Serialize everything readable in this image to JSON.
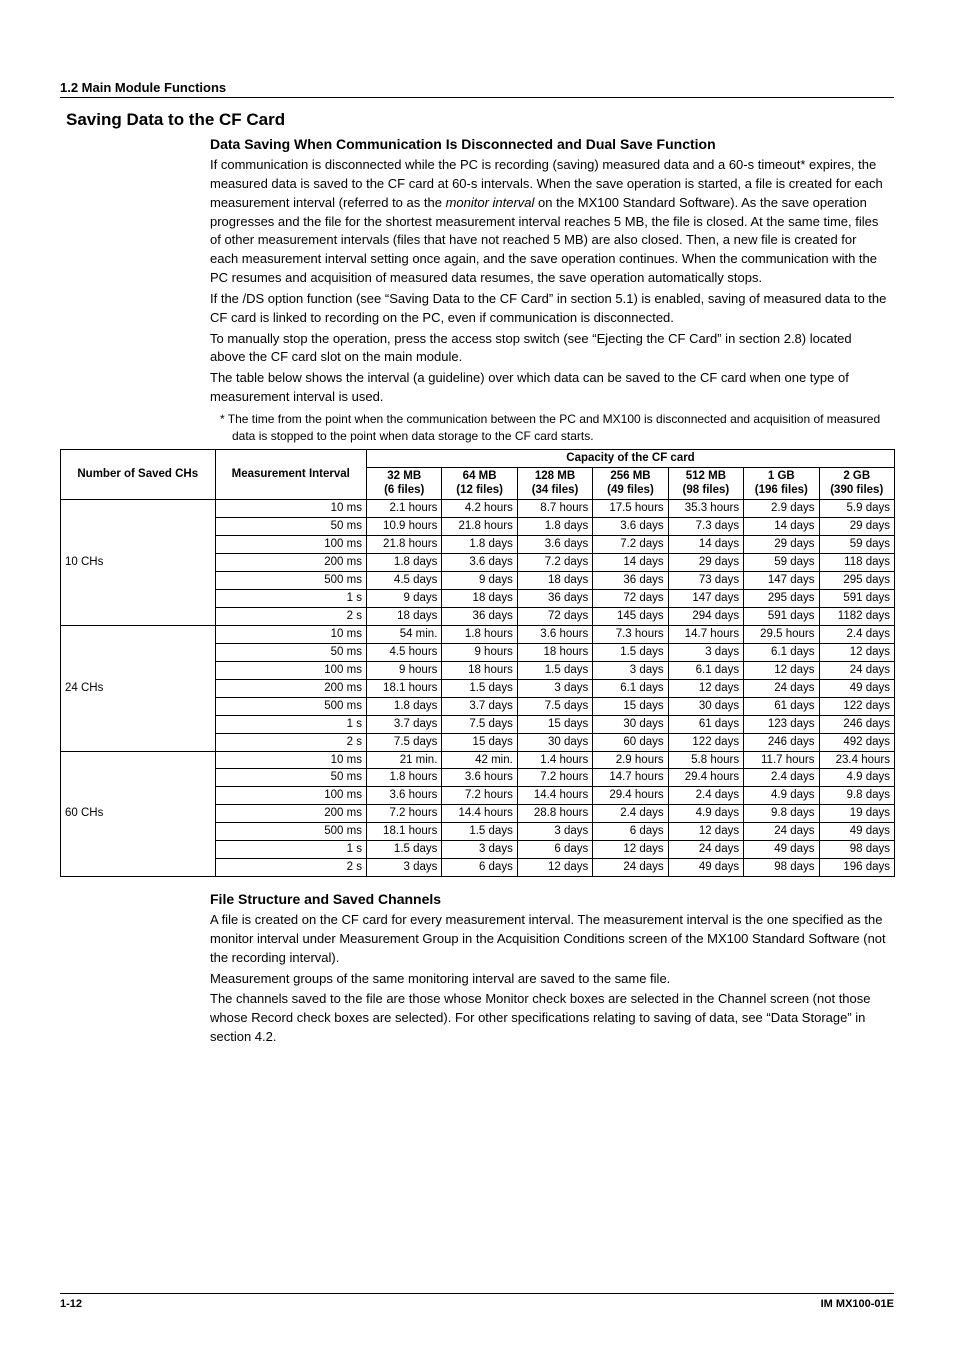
{
  "header": {
    "section": "1.2 Main Module Functions"
  },
  "title": "Saving Data to the CF Card",
  "h3a": "Data Saving When Communication Is Disconnected and Dual Save Function",
  "p1": "If communication is disconnected while the PC is recording (saving) measured data and a 60-s timeout* expires, the measured data is saved to the CF card at 60-s intervals. When the save operation is started, a file is created for each measurement interval (referred to as the ",
  "p1_i": "monitor interval",
  "p1_after": " on the MX100 Standard Software). As the save operation progresses and the file for the shortest measurement interval reaches 5 MB, the file is closed. At the same time, files of other measurement intervals (files that have not reached 5 MB) are also closed. Then, a new file is created for each measurement interval setting once again, and the save operation continues. When the communication with the PC resumes and acquisition of measured data resumes, the save operation automatically stops.",
  "p2": "If the /DS option function (see “Saving Data to the CF Card” in section 5.1) is enabled, saving of measured data to the CF card is linked to recording on the PC, even if communication is disconnected.",
  "p3": "To manually stop the operation, press the access stop switch (see “Ejecting the CF Card” in section 2.8) located above the CF card slot on the main module.",
  "p4": "The table below shows the interval (a guideline) over which data can be saved to the CF card when one type of measurement interval is used.",
  "footnote": "* The time from the point when the communication between the PC and MX100 is disconnected and acquisition of measured data is stopped to the point when data storage to the CF card starts.",
  "table": {
    "row_head": "Number of Saved CHs",
    "col_head": "Measurement Interval",
    "span_head": "Capacity of the CF card",
    "cols": [
      {
        "h1": "32 MB",
        "h2": "(6 files)"
      },
      {
        "h1": "64 MB",
        "h2": "(12 files)"
      },
      {
        "h1": "128 MB",
        "h2": "(34 files)"
      },
      {
        "h1": "256 MB",
        "h2": "(49 files)"
      },
      {
        "h1": "512 MB",
        "h2": "(98 files)"
      },
      {
        "h1": "1 GB",
        "h2": "(196 files)"
      },
      {
        "h1": "2 GB",
        "h2": "(390 files)"
      }
    ],
    "groups": [
      {
        "name": "10 CHs",
        "rows": [
          {
            "i": "10 ms",
            "v": [
              "2.1 hours",
              "4.2 hours",
              "8.7 hours",
              "17.5 hours",
              "35.3 hours",
              "2.9 days",
              "5.9 days"
            ]
          },
          {
            "i": "50 ms",
            "v": [
              "10.9 hours",
              "21.8 hours",
              "1.8 days",
              "3.6 days",
              "7.3 days",
              "14 days",
              "29 days"
            ]
          },
          {
            "i": "100 ms",
            "v": [
              "21.8 hours",
              "1.8 days",
              "3.6 days",
              "7.2 days",
              "14 days",
              "29 days",
              "59 days"
            ]
          },
          {
            "i": "200 ms",
            "v": [
              "1.8 days",
              "3.6 days",
              "7.2 days",
              "14 days",
              "29 days",
              "59 days",
              "118 days"
            ]
          },
          {
            "i": "500 ms",
            "v": [
              "4.5 days",
              "9 days",
              "18 days",
              "36 days",
              "73 days",
              "147 days",
              "295 days"
            ]
          },
          {
            "i": "1 s",
            "v": [
              "9 days",
              "18 days",
              "36 days",
              "72 days",
              "147 days",
              "295 days",
              "591 days"
            ]
          },
          {
            "i": "2 s",
            "v": [
              "18 days",
              "36 days",
              "72 days",
              "145 days",
              "294 days",
              "591 days",
              "1182 days"
            ]
          }
        ]
      },
      {
        "name": "24 CHs",
        "rows": [
          {
            "i": "10 ms",
            "v": [
              "54 min.",
              "1.8 hours",
              "3.6 hours",
              "7.3 hours",
              "14.7 hours",
              "29.5 hours",
              "2.4 days"
            ]
          },
          {
            "i": "50 ms",
            "v": [
              "4.5 hours",
              "9 hours",
              "18 hours",
              "1.5 days",
              "3 days",
              "6.1 days",
              "12 days"
            ]
          },
          {
            "i": "100 ms",
            "v": [
              "9 hours",
              "18 hours",
              "1.5 days",
              "3 days",
              "6.1 days",
              "12 days",
              "24 days"
            ]
          },
          {
            "i": "200 ms",
            "v": [
              "18.1 hours",
              "1.5 days",
              "3 days",
              "6.1 days",
              "12 days",
              "24 days",
              "49 days"
            ]
          },
          {
            "i": "500 ms",
            "v": [
              "1.8 days",
              "3.7 days",
              "7.5 days",
              "15 days",
              "30 days",
              "61 days",
              "122 days"
            ]
          },
          {
            "i": "1 s",
            "v": [
              "3.7 days",
              "7.5 days",
              "15 days",
              "30 days",
              "61 days",
              "123 days",
              "246 days"
            ]
          },
          {
            "i": "2 s",
            "v": [
              "7.5 days",
              "15 days",
              "30 days",
              "60 days",
              "122 days",
              "246 days",
              "492 days"
            ]
          }
        ]
      },
      {
        "name": "60 CHs",
        "rows": [
          {
            "i": "10 ms",
            "v": [
              "21 min.",
              "42 min.",
              "1.4 hours",
              "2.9 hours",
              "5.8 hours",
              "11.7 hours",
              "23.4 hours"
            ]
          },
          {
            "i": "50 ms",
            "v": [
              "1.8 hours",
              "3.6 hours",
              "7.2 hours",
              "14.7 hours",
              "29.4 hours",
              "2.4 days",
              "4.9 days"
            ]
          },
          {
            "i": "100 ms",
            "v": [
              "3.6 hours",
              "7.2 hours",
              "14.4 hours",
              "29.4 hours",
              "2.4 days",
              "4.9 days",
              "9.8 days"
            ]
          },
          {
            "i": "200 ms",
            "v": [
              "7.2 hours",
              "14.4 hours",
              "28.8 hours",
              "2.4 days",
              "4.9 days",
              "9.8 days",
              "19 days"
            ]
          },
          {
            "i": "500 ms",
            "v": [
              "18.1 hours",
              "1.5 days",
              "3 days",
              "6 days",
              "12 days",
              "24 days",
              "49 days"
            ]
          },
          {
            "i": "1 s",
            "v": [
              "1.5 days",
              "3 days",
              "6 days",
              "12 days",
              "24 days",
              "49 days",
              "98 days"
            ]
          },
          {
            "i": "2 s",
            "v": [
              "3 days",
              "6 days",
              "12 days",
              "24 days",
              "49 days",
              "98 days",
              "196 days"
            ]
          }
        ]
      }
    ]
  },
  "h3b": "File Structure and Saved Channels",
  "p5": "A file is created on the CF card for every measurement interval. The measurement interval is the one specified as the monitor interval under Measurement Group in the Acquisition Conditions screen of the MX100 Standard Software (not the recording interval).",
  "p6": "Measurement groups of the same monitoring interval are saved to the same file.",
  "p7": "The channels saved to the file are those whose Monitor check boxes are selected in the Channel screen (not those whose Record check boxes are selected). For other specifications relating to saving of data, see “Data Storage” in section 4.2.",
  "footer": {
    "page": "1-12",
    "doc": "IM MX100-01E"
  }
}
